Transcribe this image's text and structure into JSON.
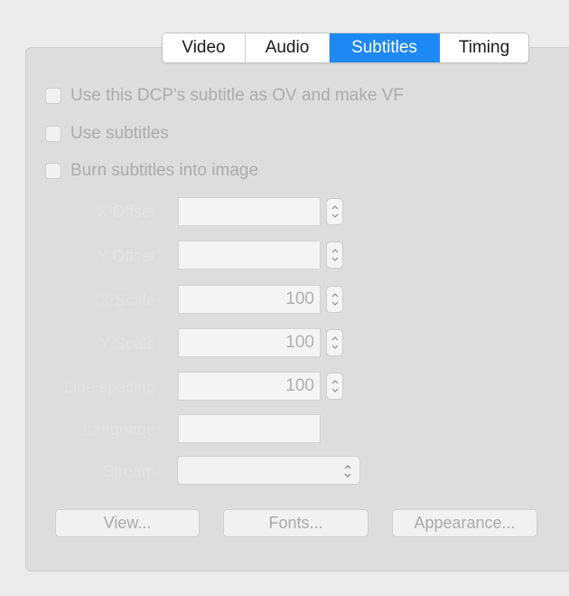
{
  "tabs": [
    {
      "label": "Video",
      "active": false
    },
    {
      "label": "Audio",
      "active": false
    },
    {
      "label": "Subtitles",
      "active": true
    },
    {
      "label": "Timing",
      "active": false
    }
  ],
  "checkboxes": {
    "use_dcp_subtitle": "Use this DCP's subtitle as OV and make VF",
    "use_subtitles": "Use subtitles",
    "burn_subtitles": "Burn subtitles into image"
  },
  "fields": {
    "row1": {
      "label": "X Offset",
      "value": ""
    },
    "row2": {
      "label": "Y Offset",
      "value": ""
    },
    "row3": {
      "label": "X Scale",
      "value": "100"
    },
    "row4": {
      "label": "Y Scale",
      "value": "100"
    },
    "row5": {
      "label": "Line spacing",
      "value": "100"
    },
    "row6": {
      "label": "Language",
      "value": ""
    },
    "row7": {
      "label": "Stream",
      "value": ""
    }
  },
  "buttons": {
    "view": "View...",
    "fonts": "Fonts...",
    "appearance": "Appearance..."
  },
  "colors": {
    "accent": "#1e88f5",
    "disabled_text": "#acacac",
    "panel_bg": "#dddddd"
  }
}
